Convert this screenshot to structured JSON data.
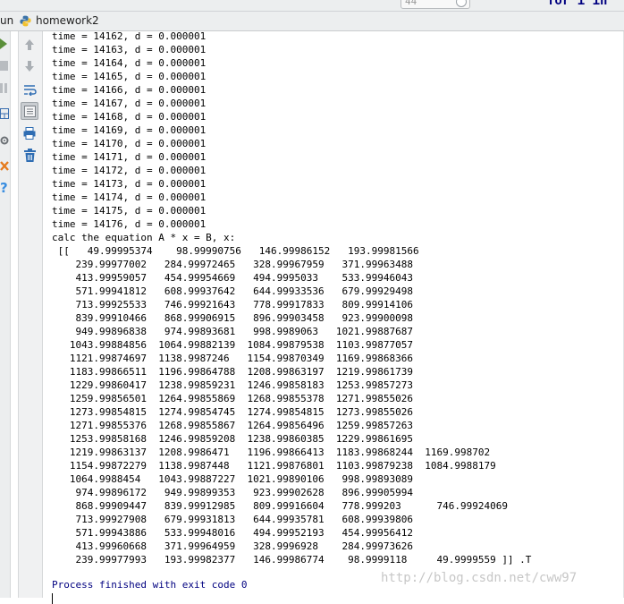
{
  "top_editor": {
    "line_number": "44",
    "code_fragment": "for i in"
  },
  "run_panel": {
    "label": "un",
    "tab_name": "homework2",
    "tab_icon": "python-icon"
  },
  "left_toolbar": [
    {
      "icon": "play-icon",
      "color": "#5a8f3a"
    },
    {
      "icon": "stop-icon",
      "color": "#9aa0a6"
    },
    {
      "icon": "pause-icon",
      "color": "#9aa0a6"
    },
    {
      "icon": "layout-icon",
      "color": "#3a6fb0"
    },
    {
      "icon": "settings-icon",
      "color": "#6b7075"
    },
    {
      "icon": "close-icon",
      "color": "#e57b1e"
    },
    {
      "icon": "help-icon",
      "color": "#3a8ee0"
    }
  ],
  "console_toolbar": [
    {
      "icon": "up-arrow-icon"
    },
    {
      "icon": "down-arrow-icon"
    },
    {
      "icon": "soft-wrap-icon"
    },
    {
      "icon": "scroll-to-end-icon",
      "pressed": true
    },
    {
      "icon": "print-icon"
    },
    {
      "icon": "trash-icon"
    }
  ],
  "console": {
    "lines": [
      "time = 14162, d = 0.000001",
      "time = 14163, d = 0.000001",
      "time = 14164, d = 0.000001",
      "time = 14165, d = 0.000001",
      "time = 14166, d = 0.000001",
      "time = 14167, d = 0.000001",
      "time = 14168, d = 0.000001",
      "time = 14169, d = 0.000001",
      "time = 14170, d = 0.000001",
      "time = 14171, d = 0.000001",
      "time = 14172, d = 0.000001",
      "time = 14173, d = 0.000001",
      "time = 14174, d = 0.000001",
      "time = 14175, d = 0.000001",
      "time = 14176, d = 0.000001",
      "calc the equation A * x = B, x:",
      " [[   49.99995374    98.99990756   146.99986152   193.99981566",
      "    239.99977002   284.99972465   328.99967959   371.99963488",
      "    413.99959057   454.99954669   494.9995033    533.99946043",
      "    571.99941812   608.99937642   644.99933536   679.99929498",
      "    713.99925533   746.99921643   778.99917833   809.99914106",
      "    839.99910466   868.99906915   896.99903458   923.99900098",
      "    949.99896838   974.99893681   998.9989063   1021.99887687",
      "   1043.99884856  1064.99882139  1084.99879538  1103.99877057",
      "   1121.99874697  1138.9987246   1154.99870349  1169.99868366",
      "   1183.99866511  1196.99864788  1208.99863197  1219.99861739",
      "   1229.99860417  1238.99859231  1246.99858183  1253.99857273",
      "   1259.99856501  1264.99855869  1268.99855378  1271.99855026",
      "   1273.99854815  1274.99854745  1274.99854815  1273.99855026",
      "   1271.99855376  1268.99855867  1264.99856496  1259.99857263",
      "   1253.99858168  1246.99859208  1238.99860385  1229.99861695",
      "   1219.99863137  1208.9986471   1196.99866413  1183.99868244  1169.998702",
      "   1154.99872279  1138.9987448   1121.99876801  1103.99879238  1084.9988179",
      "   1064.9988454   1043.99887227  1021.99890106   998.99893089",
      "    974.99896172   949.99899353   923.99902628   896.99905994",
      "    868.99909447   839.99912985   809.99916604   778.999203      746.99924069",
      "    713.99927908   679.99931813   644.99935781   608.99939806",
      "    571.99943886   533.99948016   494.99952193   454.99956412",
      "    413.99960668   371.99964959   328.9996928    284.99973626",
      "    239.99977993   193.99982377   146.99986774    98.9999118     49.9999559 ]] .T"
    ],
    "exit_message": "Process finished with exit code 0"
  },
  "watermark": "http://blog.csdn.net/cww97",
  "colors": {
    "console_text": "#000000",
    "exit_text": "#000080",
    "panel_bg": "#eceeef"
  }
}
